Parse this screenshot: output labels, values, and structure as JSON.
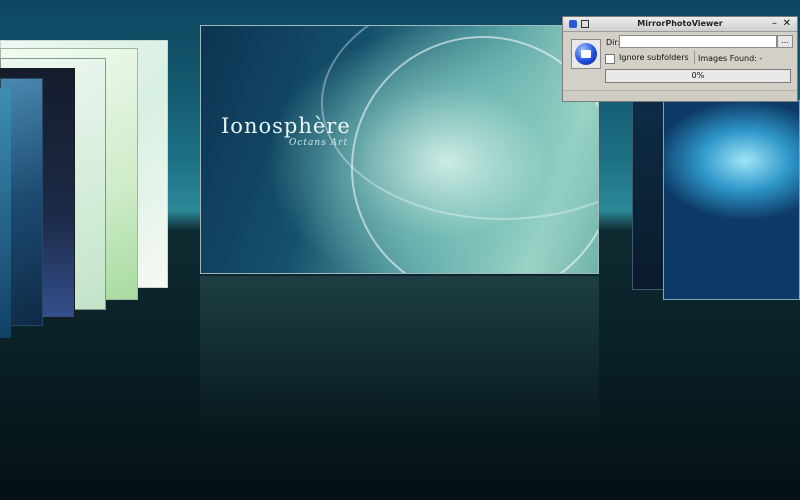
{
  "window": {
    "title": "MirrorPhotoViewer",
    "min_glyph": "–",
    "close_glyph": "✕",
    "dir_label": "Dir:",
    "dir_value": "",
    "browse_label": "...",
    "ignore_subfolders_label": "Ignore subfolders",
    "ignore_subfolders_checked": false,
    "images_found_label": "Images Found: -",
    "progress_text": "0%",
    "progress_value": 0
  },
  "center_image": {
    "logo_text": "Ionosphère",
    "sub_text": "Octans Art"
  },
  "colors": {
    "background_top": "#0d4660",
    "accent_blue": "#2a5bd7"
  }
}
